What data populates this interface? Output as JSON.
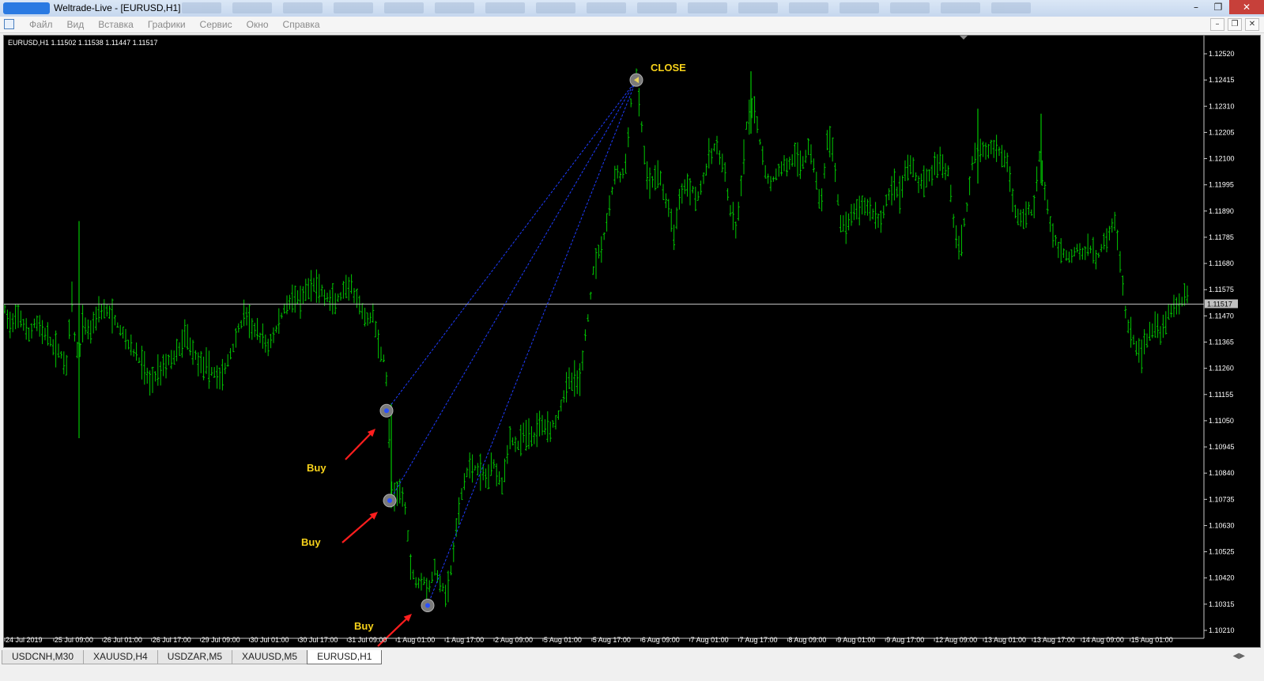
{
  "window": {
    "title": "Weltrade-Live - [EURUSD,H1]",
    "minimize_icon": "minimize-icon",
    "maximize_icon": "restore-icon",
    "close_icon": "close-icon"
  },
  "menu": {
    "items": [
      "Файл",
      "Вид",
      "Вставка",
      "Графики",
      "Сервис",
      "Окно",
      "Справка"
    ]
  },
  "chart_info": "EURUSD,H1  1.11502 1.11538 1.11447 1.11517",
  "annotations": {
    "close_label": "CLOSE",
    "buy_labels": [
      "Buy",
      "Buy",
      "Buy"
    ]
  },
  "colors": {
    "bars": "#00c800",
    "background": "#000000",
    "price_line": "#c0c0c0",
    "label_text": "#f7d21a",
    "arrow": "#ff1e1e",
    "trade_line": "#1e3cff"
  },
  "chart_data": {
    "type": "ohlc",
    "symbol": "EURUSD",
    "timeframe": "H1",
    "current_price": "1.11517",
    "y_axis_ticks": [
      "1.12520",
      "1.12415",
      "1.12310",
      "1.12205",
      "1.12100",
      "1.11995",
      "1.11890",
      "1.11785",
      "1.11680",
      "1.11575",
      "1.11470",
      "1.11365",
      "1.11260",
      "1.11155",
      "1.11050",
      "1.10945",
      "1.10840",
      "1.10735",
      "1.10630",
      "1.10525",
      "1.10420",
      "1.10315",
      "1.10210"
    ],
    "ylim": [
      1.102,
      1.1255
    ],
    "x_axis_ticks": [
      "24 Jul 2019",
      "25 Jul 09:00",
      "26 Jul 01:00",
      "26 Jul 17:00",
      "29 Jul 09:00",
      "30 Jul 01:00",
      "30 Jul 17:00",
      "31 Jul 09:00",
      "1 Aug 01:00",
      "1 Aug 17:00",
      "2 Aug 09:00",
      "5 Aug 01:00",
      "5 Aug 17:00",
      "6 Aug 09:00",
      "7 Aug 01:00",
      "7 Aug 17:00",
      "8 Aug 09:00",
      "9 Aug 01:00",
      "9 Aug 17:00",
      "12 Aug 09:00",
      "13 Aug 01:00",
      "13 Aug 17:00",
      "14 Aug 09:00",
      "15 Aug 01:00"
    ],
    "path": [
      [
        0,
        1.115
      ],
      [
        10,
        1.1142
      ],
      [
        20,
        1.1148
      ],
      [
        30,
        1.1138
      ],
      [
        40,
        1.1145
      ],
      [
        55,
        1.1138
      ],
      [
        70,
        1.1132
      ],
      [
        80,
        1.1128
      ],
      [
        86,
        1.1155
      ],
      [
        90,
        1.1135
      ],
      [
        95,
        1.113
      ],
      [
        100,
        1.1145
      ],
      [
        108,
        1.114
      ],
      [
        120,
        1.115
      ],
      [
        135,
        1.1148
      ],
      [
        150,
        1.114
      ],
      [
        165,
        1.1132
      ],
      [
        175,
        1.1128
      ],
      [
        185,
        1.112
      ],
      [
        195,
        1.1125
      ],
      [
        205,
        1.1128
      ],
      [
        220,
        1.1132
      ],
      [
        230,
        1.114
      ],
      [
        240,
        1.1132
      ],
      [
        250,
        1.1128
      ],
      [
        262,
        1.1125
      ],
      [
        275,
        1.1122
      ],
      [
        285,
        1.113
      ],
      [
        295,
        1.114
      ],
      [
        305,
        1.1148
      ],
      [
        315,
        1.1142
      ],
      [
        325,
        1.1138
      ],
      [
        335,
        1.1135
      ],
      [
        345,
        1.1142
      ],
      [
        355,
        1.115
      ],
      [
        365,
        1.1155
      ],
      [
        375,
        1.1152
      ],
      [
        385,
        1.1158
      ],
      [
        395,
        1.116
      ],
      [
        405,
        1.1155
      ],
      [
        418,
        1.1152
      ],
      [
        430,
        1.1156
      ],
      [
        440,
        1.1158
      ],
      [
        450,
        1.115
      ],
      [
        460,
        1.1145
      ],
      [
        468,
        1.1148
      ],
      [
        475,
        1.1132
      ],
      [
        482,
        1.113
      ],
      [
        486,
        1.111
      ],
      [
        490,
        1.1078
      ],
      [
        495,
        1.1072
      ],
      [
        502,
        1.1078
      ],
      [
        508,
        1.107
      ],
      [
        515,
        1.1045
      ],
      [
        522,
        1.104
      ],
      [
        530,
        1.1042
      ],
      [
        537,
        1.1038
      ],
      [
        545,
        1.1045
      ],
      [
        552,
        1.104
      ],
      [
        560,
        1.1035
      ],
      [
        568,
        1.105
      ],
      [
        575,
        1.1068
      ],
      [
        582,
        1.108
      ],
      [
        590,
        1.1088
      ],
      [
        600,
        1.1085
      ],
      [
        610,
        1.1082
      ],
      [
        620,
        1.1088
      ],
      [
        630,
        1.108
      ],
      [
        640,
        1.1098
      ],
      [
        650,
        1.1095
      ],
      [
        660,
        1.11
      ],
      [
        670,
        1.1098
      ],
      [
        680,
        1.1105
      ],
      [
        690,
        1.1102
      ],
      [
        700,
        1.1106
      ],
      [
        710,
        1.1118
      ],
      [
        720,
        1.1122
      ],
      [
        728,
        1.112
      ],
      [
        735,
        1.1138
      ],
      [
        740,
        1.1148
      ],
      [
        745,
        1.1165
      ],
      [
        752,
        1.1172
      ],
      [
        760,
        1.118
      ],
      [
        768,
        1.1195
      ],
      [
        775,
        1.1205
      ],
      [
        782,
        1.1202
      ],
      [
        788,
        1.121
      ],
      [
        795,
        1.124
      ],
      [
        800,
        1.1242
      ],
      [
        806,
        1.1225
      ],
      [
        812,
        1.1205
      ],
      [
        818,
        1.1198
      ],
      [
        825,
        1.1205
      ],
      [
        832,
        1.12
      ],
      [
        840,
        1.119
      ],
      [
        848,
        1.118
      ],
      [
        855,
        1.1195
      ],
      [
        862,
        1.12
      ],
      [
        870,
        1.1198
      ],
      [
        878,
        1.1195
      ],
      [
        885,
        1.1202
      ],
      [
        892,
        1.121
      ],
      [
        900,
        1.1215
      ],
      [
        910,
        1.1208
      ],
      [
        918,
        1.119
      ],
      [
        926,
        1.118
      ],
      [
        933,
        1.12
      ],
      [
        940,
        1.1225
      ],
      [
        948,
        1.123
      ],
      [
        955,
        1.122
      ],
      [
        962,
        1.1205
      ],
      [
        970,
        1.12
      ],
      [
        980,
        1.1205
      ],
      [
        990,
        1.1208
      ],
      [
        1000,
        1.121
      ],
      [
        1010,
        1.1208
      ],
      [
        1018,
        1.1215
      ],
      [
        1026,
        1.1205
      ],
      [
        1034,
        1.119
      ],
      [
        1042,
        1.122
      ],
      [
        1050,
        1.121
      ],
      [
        1058,
        1.1185
      ],
      [
        1066,
        1.1182
      ],
      [
        1074,
        1.1188
      ],
      [
        1082,
        1.119
      ],
      [
        1090,
        1.1192
      ],
      [
        1100,
        1.1188
      ],
      [
        1110,
        1.1185
      ],
      [
        1118,
        1.1195
      ],
      [
        1126,
        1.12
      ],
      [
        1134,
        1.1195
      ],
      [
        1142,
        1.1208
      ],
      [
        1150,
        1.1205
      ],
      [
        1158,
        1.12
      ],
      [
        1166,
        1.1202
      ],
      [
        1175,
        1.1205
      ],
      [
        1185,
        1.1208
      ],
      [
        1195,
        1.1205
      ],
      [
        1203,
        1.118
      ],
      [
        1210,
        1.1175
      ],
      [
        1218,
        1.119
      ],
      [
        1226,
        1.1212
      ],
      [
        1234,
        1.1215
      ],
      [
        1242,
        1.1212
      ],
      [
        1252,
        1.1215
      ],
      [
        1262,
        1.1212
      ],
      [
        1270,
        1.1208
      ],
      [
        1278,
        1.119
      ],
      [
        1286,
        1.1185
      ],
      [
        1294,
        1.119
      ],
      [
        1302,
        1.1188
      ],
      [
        1310,
        1.121
      ],
      [
        1318,
        1.1195
      ],
      [
        1325,
        1.118
      ],
      [
        1333,
        1.1175
      ],
      [
        1341,
        1.1172
      ],
      [
        1349,
        1.117
      ],
      [
        1357,
        1.1175
      ],
      [
        1365,
        1.1172
      ],
      [
        1373,
        1.1175
      ],
      [
        1381,
        1.1168
      ],
      [
        1389,
        1.1175
      ],
      [
        1397,
        1.118
      ],
      [
        1405,
        1.1185
      ],
      [
        1412,
        1.117
      ],
      [
        1418,
        1.115
      ],
      [
        1424,
        1.114
      ],
      [
        1432,
        1.1135
      ],
      [
        1440,
        1.1132
      ],
      [
        1448,
        1.114
      ],
      [
        1456,
        1.1142
      ],
      [
        1464,
        1.114
      ],
      [
        1472,
        1.1148
      ],
      [
        1480,
        1.115
      ],
      [
        1488,
        1.1152
      ],
      [
        1496,
        1.1155
      ],
      [
        1500,
        1.1152
      ]
    ],
    "spikes": [
      [
        95,
        1.1185,
        1.1098
      ],
      [
        945,
        1.1245,
        1.122
      ],
      [
        1232,
        1.123,
        1.12
      ],
      [
        1312,
        1.1228,
        1.12
      ],
      [
        490,
        1.1112,
        1.107
      ]
    ],
    "trades": {
      "close": {
        "x": 800,
        "price": 1.12415
      },
      "entries": [
        {
          "x": 484,
          "price": 1.1109
        },
        {
          "x": 488,
          "price": 1.1073
        },
        {
          "x": 536,
          "price": 1.1031
        }
      ]
    }
  },
  "tabs": [
    {
      "label": "USDCNH,M30",
      "active": false
    },
    {
      "label": "XAUUSD,H4",
      "active": false
    },
    {
      "label": "USDZAR,M5",
      "active": false
    },
    {
      "label": "XAUUSD,M5",
      "active": false
    },
    {
      "label": "EURUSD,H1",
      "active": true
    }
  ]
}
